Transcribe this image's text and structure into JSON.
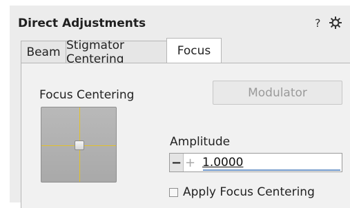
{
  "panel": {
    "title": "Direct Adjustments",
    "help_label": "?",
    "settings_icon": "gear-icon"
  },
  "tabs": [
    {
      "label": "Beam",
      "active": false
    },
    {
      "label": "Stigmator Centering",
      "active": false
    },
    {
      "label": "Focus",
      "active": true
    }
  ],
  "focus": {
    "section_label": "Focus Centering",
    "modulator_label": "Modulator",
    "amplitude_label": "Amplitude",
    "amplitude_value": "1.0000",
    "minus_label": "−",
    "plus_label": "+",
    "apply_label": "Apply Focus Centering",
    "apply_checked": false
  },
  "colors": {
    "crosshair": "#e3c12a",
    "focus_underline": "#6f97c9"
  }
}
